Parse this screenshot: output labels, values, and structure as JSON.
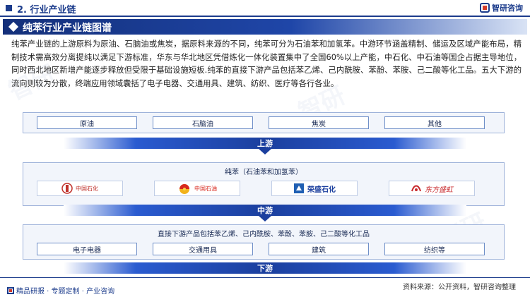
{
  "header": {
    "section_title": "2. 行业产业链",
    "brand_name": "智研咨询"
  },
  "banner": {
    "title": "纯苯行业产业链图谱"
  },
  "intro_text": "纯苯产业链的上游原料为原油、石脑油或焦炭，据原料来源的不同，纯苯可分为石油苯和加氢苯。中游环节涵盖精制、储运及区域产能布局，精制技术需高效分离提纯以满足下游标准，华东与华北地区凭借炼化一体化装置集中了全国60%以上产能，中石化、中石油等国企占据主导地位，同时西北地区新增产能逐步释放但受限于基础设施短板.纯苯的直接下游产品包括苯乙烯、己内酰胺、苯酚、苯胺、己二酸等化工品。五大下游的流向则较为分散，终端应用领域囊括了电子电器、交通用具、建筑、纺织、医疗等各行各业。",
  "upstream": {
    "items": [
      "原油",
      "石脑油",
      "焦炭",
      "其他"
    ],
    "band_label": "上游"
  },
  "midstream": {
    "subtitle": "纯苯（石油苯和加氢苯）",
    "companies": [
      "中国石化",
      "中国石油",
      "荣盛石化",
      "东方盛虹"
    ],
    "band_label": "中游"
  },
  "downstream": {
    "subtitle": "直接下游产品包括苯乙烯、己内酰胺、苯酚、苯胺、己二酸等化工品",
    "items": [
      "电子电器",
      "交通用具",
      "建筑",
      "纺织等"
    ],
    "band_label": "下游"
  },
  "footer": {
    "left_text": "精品研报 · 专题定制 · 产业咨询",
    "source": "资料来源：公开资料，智研咨询整理"
  },
  "colors": {
    "primary": "#1c3c8c",
    "accent_red": "#d23a2a",
    "band_blue": "#1b3f9e"
  }
}
